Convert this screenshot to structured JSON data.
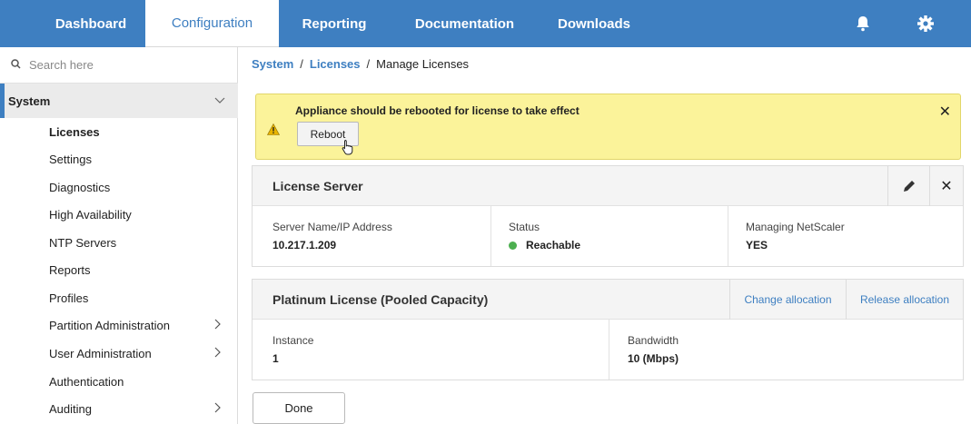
{
  "nav": {
    "tabs": [
      "Dashboard",
      "Configuration",
      "Reporting",
      "Documentation",
      "Downloads"
    ],
    "active_tab": "Configuration",
    "icons": [
      "bell-icon",
      "gear-icon"
    ]
  },
  "sidebar": {
    "search_placeholder": "Search here",
    "section": "System",
    "items": [
      {
        "label": "Licenses",
        "active": true
      },
      {
        "label": "Settings"
      },
      {
        "label": "Diagnostics"
      },
      {
        "label": "High Availability"
      },
      {
        "label": "NTP Servers"
      },
      {
        "label": "Reports"
      },
      {
        "label": "Profiles"
      },
      {
        "label": "Partition Administration",
        "has_children": true
      },
      {
        "label": "User Administration",
        "has_children": true
      },
      {
        "label": "Authentication"
      },
      {
        "label": "Auditing",
        "has_children": true
      }
    ]
  },
  "breadcrumb": {
    "items": [
      "System",
      "Licenses",
      "Manage Licenses"
    ],
    "separator": "/"
  },
  "alert": {
    "message": "Appliance should be rebooted for license to take effect",
    "button": "Reboot",
    "close": "✕"
  },
  "license_server": {
    "title": "License Server",
    "fields": [
      {
        "label": "Server Name/IP Address",
        "value": "10.217.1.209"
      },
      {
        "label": "Status",
        "value": "Reachable",
        "status_color": "#4caf50"
      },
      {
        "label": "Managing NetScaler",
        "value": "YES"
      }
    ],
    "close": "✕"
  },
  "platinum": {
    "title": "Platinum License (Pooled Capacity)",
    "actions": [
      "Change allocation",
      "Release allocation"
    ],
    "fields": [
      {
        "label": "Instance",
        "value": "1"
      },
      {
        "label": "Bandwidth",
        "value": "10 (Mbps)"
      }
    ]
  },
  "done_button": "Done",
  "colors": {
    "accent": "#3e7fc1",
    "alert_bg": "#fbf39a",
    "ok": "#4caf50"
  }
}
